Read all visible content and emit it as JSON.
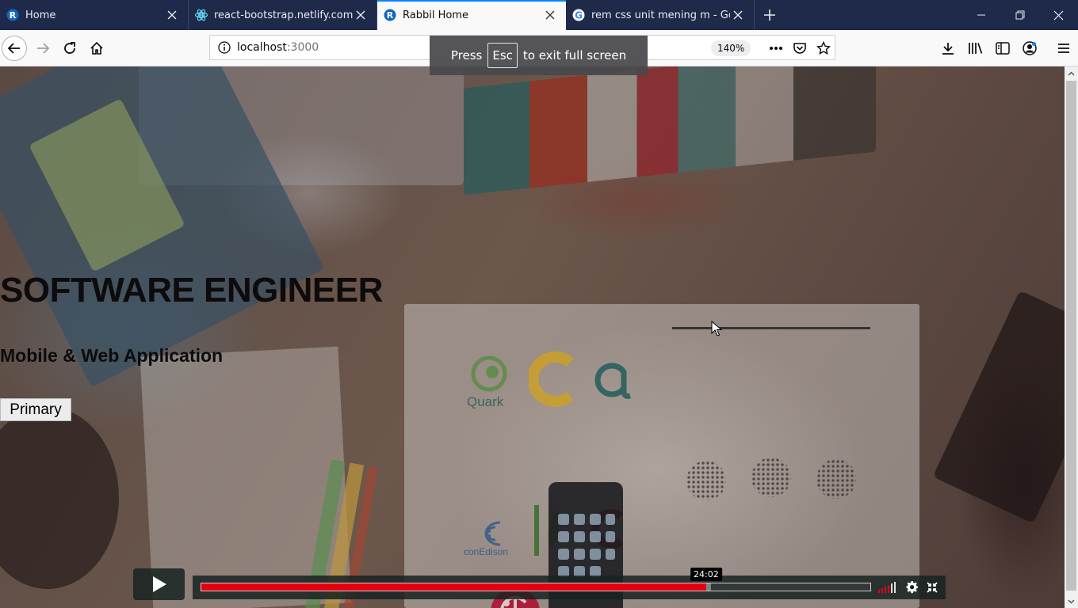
{
  "browser": {
    "tabs": [
      {
        "title": "Home",
        "favicon": "rabbil-logo-icon",
        "active": false
      },
      {
        "title": "react-bootstrap.netlify.com/co",
        "favicon": "react-bootstrap-icon",
        "active": false
      },
      {
        "title": "Rabbil Home",
        "favicon": "rabbil-logo-icon",
        "active": true
      },
      {
        "title": "rem css unit mening m - Googl",
        "favicon": "google-icon",
        "active": false
      }
    ],
    "url": {
      "host": "localhost",
      "port": ":3000"
    },
    "zoom": "140%",
    "fullscreen_notice": {
      "press": "Press",
      "key": "Esc",
      "rest": "to exit full screen"
    }
  },
  "page": {
    "hero_title": "SOFTWARE ENGINEER",
    "hero_subtitle": "Mobile & Web Application",
    "primary_button": "Primary"
  },
  "scene_text": {
    "quark": "Quark",
    "conedison": "conEdison"
  },
  "video": {
    "progress": 0.755,
    "buffered": 0.762,
    "hover_time": "24:02",
    "hover_position": 0.754,
    "volume_level": 0.6
  },
  "colors": {
    "tab_bar": "#1f2a4b",
    "active_tab_accent": "#0a84ff",
    "progress_fill": "#e6000e"
  }
}
